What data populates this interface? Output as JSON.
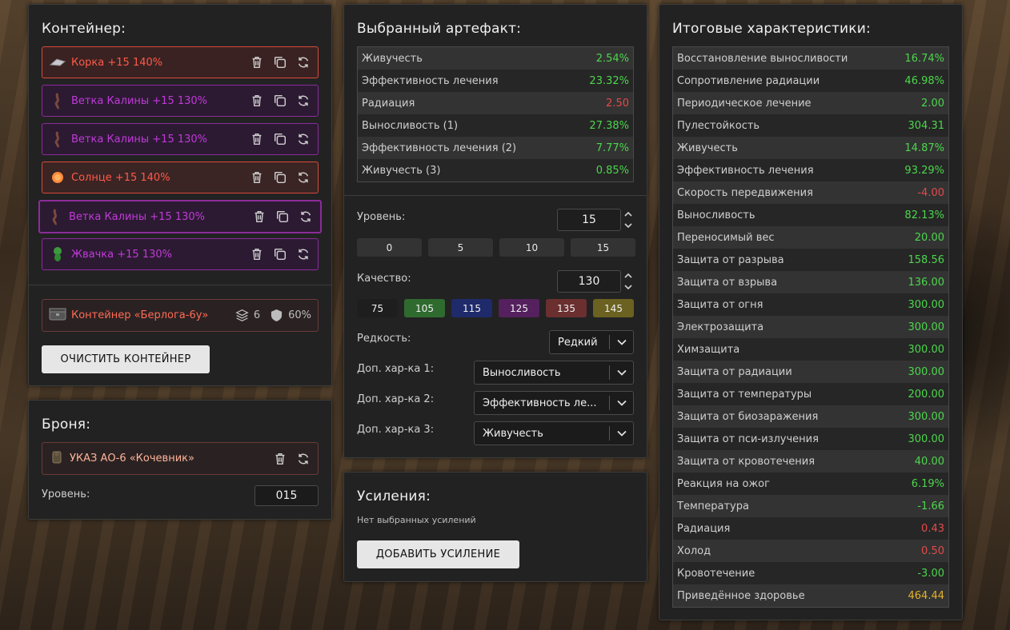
{
  "container": {
    "title": "Контейнер:",
    "slots": [
      {
        "name": "Корка +15 140%",
        "icon": "shard-icon",
        "color": "#ff5a48"
      },
      {
        "name": "Ветка Калины +15 130%",
        "icon": "branch-icon",
        "color": "#c13ad8"
      },
      {
        "name": "Ветка Калины +15 130%",
        "icon": "branch-icon",
        "color": "#c13ad8"
      },
      {
        "name": "Солнце +15 140%",
        "icon": "sun-icon",
        "color": "#ff5a48"
      },
      {
        "name": "Ветка Калины +15 130%",
        "icon": "branch-icon",
        "color": "#c13ad8"
      },
      {
        "name": "Жвачка +15 130%",
        "icon": "gum-icon",
        "color": "#c13ad8"
      }
    ],
    "container_name": "Контейнер «Берлога-6у»",
    "slots_count": "6",
    "protection": "60%",
    "clear_label": "ОЧИСТИТЬ КОНТЕЙНЕР"
  },
  "armor": {
    "title": "Броня:",
    "name": "УКАЗ АО-6 «Кочевник»",
    "level_label": "Уровень:",
    "level_value": "015"
  },
  "artifact": {
    "title": "Выбранный артефакт:",
    "stats": [
      {
        "label": "Живучесть",
        "value": "2.54%",
        "tone": "green"
      },
      {
        "label": "Эффективность лечения",
        "value": "23.32%",
        "tone": "green"
      },
      {
        "label": "Радиация",
        "value": "2.50",
        "tone": "red"
      },
      {
        "label": "Выносливость (1)",
        "value": "27.38%",
        "tone": "green"
      },
      {
        "label": "Эффективность лечения (2)",
        "value": "7.77%",
        "tone": "green"
      },
      {
        "label": "Живучесть (3)",
        "value": "0.85%",
        "tone": "green"
      }
    ],
    "level_label": "Уровень:",
    "level_value": "15",
    "level_presets": [
      "0",
      "5",
      "10",
      "15"
    ],
    "quality_label": "Качество:",
    "quality_value": "130",
    "quality_presets": [
      {
        "label": "75",
        "color": "#1e1e1e"
      },
      {
        "label": "105",
        "color": "#2f6b2f"
      },
      {
        "label": "115",
        "color": "#1f2a6b"
      },
      {
        "label": "125",
        "color": "#55205e"
      },
      {
        "label": "135",
        "color": "#6b2f2f"
      },
      {
        "label": "145",
        "color": "#6b6120"
      }
    ],
    "rarity_label": "Редкость:",
    "rarity_value": "Редкий",
    "extra1_label": "Доп. хар-ка 1:",
    "extra1_value": "Выносливость",
    "extra2_label": "Доп. хар-ка 2:",
    "extra2_value": "Эффективность ле...",
    "extra3_label": "Доп. хар-ка 3:",
    "extra3_value": "Живучесть"
  },
  "boosts": {
    "title": "Усиления:",
    "empty_text": "Нет выбранных усилений",
    "add_label": "ДОБАВИТЬ УСИЛЕНИЕ"
  },
  "totals": {
    "title": "Итоговые характеристики:",
    "stats": [
      {
        "label": "Восстановление выносливости",
        "value": "16.74%",
        "tone": "green"
      },
      {
        "label": "Сопротивление радиации",
        "value": "46.98%",
        "tone": "green"
      },
      {
        "label": "Периодическое лечение",
        "value": "2.00",
        "tone": "green"
      },
      {
        "label": "Пулестойкость",
        "value": "304.31",
        "tone": "green"
      },
      {
        "label": "Живучесть",
        "value": "14.87%",
        "tone": "green"
      },
      {
        "label": "Эффективность лечения",
        "value": "93.29%",
        "tone": "green"
      },
      {
        "label": "Скорость передвижения",
        "value": "-4.00",
        "tone": "red"
      },
      {
        "label": "Выносливость",
        "value": "82.13%",
        "tone": "green"
      },
      {
        "label": "Переносимый вес",
        "value": "20.00",
        "tone": "green"
      },
      {
        "label": "Защита от разрыва",
        "value": "158.56",
        "tone": "green"
      },
      {
        "label": "Защита от взрыва",
        "value": "136.00",
        "tone": "green"
      },
      {
        "label": "Защита от огня",
        "value": "300.00",
        "tone": "green"
      },
      {
        "label": "Электрозащита",
        "value": "300.00",
        "tone": "green"
      },
      {
        "label": "Химзащита",
        "value": "300.00",
        "tone": "green"
      },
      {
        "label": "Защита от радиации",
        "value": "300.00",
        "tone": "green"
      },
      {
        "label": "Защита от температуры",
        "value": "200.00",
        "tone": "green"
      },
      {
        "label": "Защита от биозаражения",
        "value": "300.00",
        "tone": "green"
      },
      {
        "label": "Защита от пси-излучения",
        "value": "300.00",
        "tone": "green"
      },
      {
        "label": "Защита от кровотечения",
        "value": "40.00",
        "tone": "green"
      },
      {
        "label": "Реакция на ожог",
        "value": "6.19%",
        "tone": "green"
      },
      {
        "label": "Температура",
        "value": "-1.66",
        "tone": "green"
      },
      {
        "label": "Радиация",
        "value": "0.43",
        "tone": "red"
      },
      {
        "label": "Холод",
        "value": "0.50",
        "tone": "red"
      },
      {
        "label": "Кровотечение",
        "value": "-3.00",
        "tone": "green"
      },
      {
        "label": "Приведённое здоровье",
        "value": "464.44",
        "tone": "gold"
      }
    ]
  }
}
